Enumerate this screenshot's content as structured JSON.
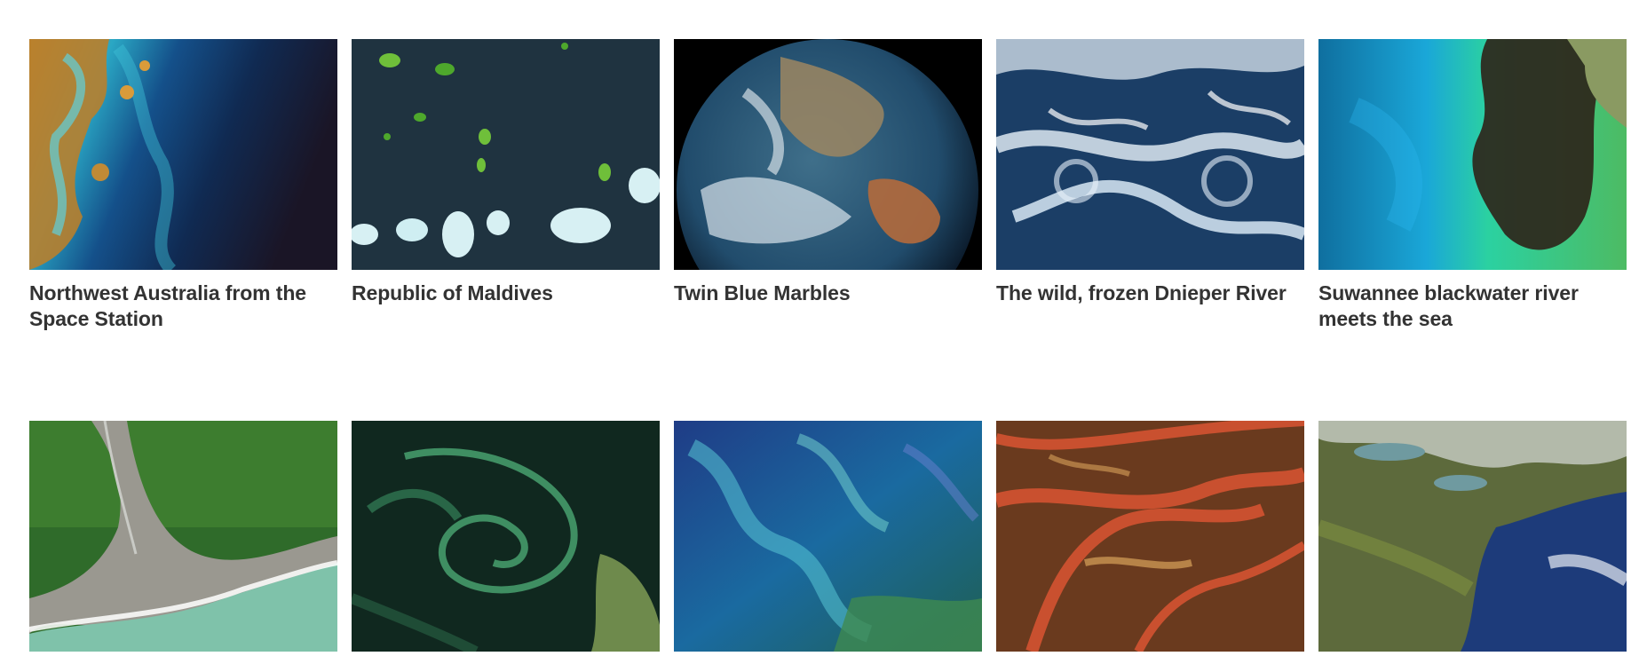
{
  "gallery": {
    "items": [
      {
        "title": "Northwest Australia from the Space Station",
        "image": "northwest-australia-photo"
      },
      {
        "title": "Republic of Maldives",
        "image": "maldives-atolls-photo"
      },
      {
        "title": "Twin Blue Marbles",
        "image": "blue-marble-earth-photo"
      },
      {
        "title": "The wild, frozen Dnieper River",
        "image": "frozen-river-photo"
      },
      {
        "title": "Suwannee blackwater river meets the sea",
        "image": "blackwater-river-photo"
      },
      {
        "title": "",
        "image": "glacier-delta-coast-photo"
      },
      {
        "title": "",
        "image": "phytoplankton-swirl-photo"
      },
      {
        "title": "",
        "image": "ocean-bloom-photo"
      },
      {
        "title": "",
        "image": "red-river-delta-photo"
      },
      {
        "title": "",
        "image": "east-coast-satellite-photo"
      }
    ]
  }
}
